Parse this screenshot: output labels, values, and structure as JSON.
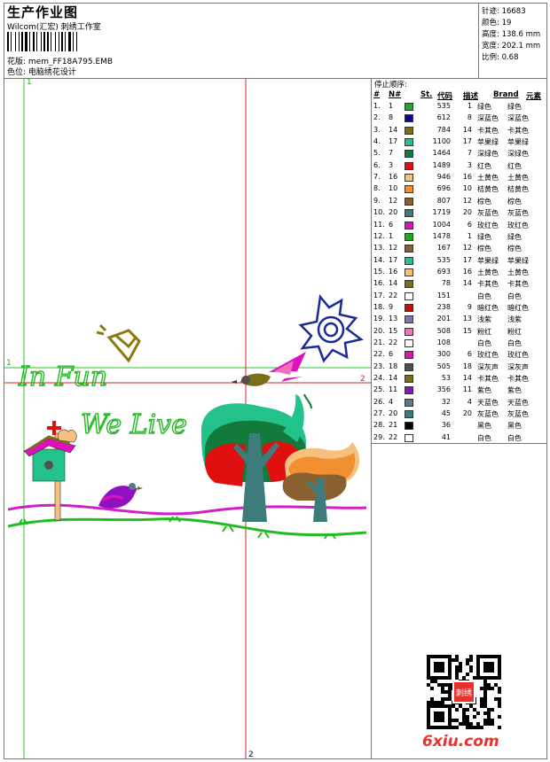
{
  "header": {
    "title": "生产作业图",
    "company": "Wilcom(汇宏) 刺绣工作室",
    "design_label": "花版: mem_FF18A795.EMB",
    "colorway_label": "色位: 电脑绣花设计"
  },
  "stats": [
    "针迹: 16683",
    "颜色: 19",
    "高度: 138.6 mm",
    "宽度: 202.1 mm",
    "比例: 0.68"
  ],
  "stop_sequence": {
    "title": "停止顺序:",
    "headers": [
      "#",
      "N#",
      "St.",
      "代码",
      "描述",
      "Brand",
      "元素"
    ],
    "rows": [
      {
        "num": "1.",
        "n": "1",
        "st": "535",
        "code": "1",
        "desc": "绿色",
        "brand": "绿色",
        "color": "#22aa22"
      },
      {
        "num": "2.",
        "n": "8",
        "st": "612",
        "code": "8",
        "desc": "深蓝色",
        "brand": "深蓝色",
        "color": "#0a0a8a"
      },
      {
        "num": "3.",
        "n": "14",
        "st": "784",
        "code": "14",
        "desc": "卡其色",
        "brand": "卡其色",
        "color": "#7a6e18"
      },
      {
        "num": "4.",
        "n": "17",
        "st": "1100",
        "code": "17",
        "desc": "苹果绿",
        "brand": "苹果绿",
        "color": "#22c28a"
      },
      {
        "num": "5.",
        "n": "7",
        "st": "1464",
        "code": "7",
        "desc": "深绿色",
        "brand": "深绿色",
        "color": "#127a3a"
      },
      {
        "num": "6.",
        "n": "3",
        "st": "1489",
        "code": "3",
        "desc": "红色",
        "brand": "红色",
        "color": "#e01010"
      },
      {
        "num": "7.",
        "n": "16",
        "st": "946",
        "code": "16",
        "desc": "土黄色",
        "brand": "土黄色",
        "color": "#f5c080"
      },
      {
        "num": "8.",
        "n": "10",
        "st": "696",
        "code": "10",
        "desc": "桔黄色",
        "brand": "桔黄色",
        "color": "#f09030"
      },
      {
        "num": "9.",
        "n": "12",
        "st": "807",
        "code": "12",
        "desc": "棕色",
        "brand": "棕色",
        "color": "#8a6030"
      },
      {
        "num": "10.",
        "n": "20",
        "st": "1719",
        "code": "20",
        "desc": "灰蓝色",
        "brand": "灰蓝色",
        "color": "#3e7c7c"
      },
      {
        "num": "11.",
        "n": "6",
        "st": "1004",
        "code": "6",
        "desc": "玫红色",
        "brand": "玫红色",
        "color": "#e010c0"
      },
      {
        "num": "12.",
        "n": "1",
        "st": "1478",
        "code": "1",
        "desc": "绿色",
        "brand": "绿色",
        "color": "#22aa22"
      },
      {
        "num": "13.",
        "n": "12",
        "st": "167",
        "code": "12",
        "desc": "棕色",
        "brand": "棕色",
        "color": "#8a6030"
      },
      {
        "num": "14.",
        "n": "17",
        "st": "535",
        "code": "17",
        "desc": "苹果绿",
        "brand": "苹果绿",
        "color": "#22c28a"
      },
      {
        "num": "15.",
        "n": "16",
        "st": "693",
        "code": "16",
        "desc": "土黄色",
        "brand": "土黄色",
        "color": "#f5c080"
      },
      {
        "num": "16.",
        "n": "14",
        "st": "78",
        "code": "14",
        "desc": "卡其色",
        "brand": "卡其色",
        "color": "#7a6e18"
      },
      {
        "num": "17.",
        "n": "22",
        "st": "151",
        "code": "",
        "desc": "白色",
        "brand": "白色",
        "color": "#ffffff"
      },
      {
        "num": "18.",
        "n": "9",
        "st": "238",
        "code": "9",
        "desc": "暗红色",
        "brand": "暗红色",
        "color": "#c01010"
      },
      {
        "num": "19.",
        "n": "13",
        "st": "201",
        "code": "13",
        "desc": "浅紫",
        "brand": "浅紫",
        "color": "#7878b8"
      },
      {
        "num": "20.",
        "n": "15",
        "st": "508",
        "code": "15",
        "desc": "粉红",
        "brand": "粉红",
        "color": "#f070c0"
      },
      {
        "num": "21.",
        "n": "22",
        "st": "108",
        "code": "",
        "desc": "白色",
        "brand": "白色",
        "color": "#ffffff"
      },
      {
        "num": "22.",
        "n": "6",
        "st": "300",
        "code": "6",
        "desc": "玫红色",
        "brand": "玫红色",
        "color": "#e010c0"
      },
      {
        "num": "23.",
        "n": "18",
        "st": "505",
        "code": "18",
        "desc": "深灰声",
        "brand": "深灰声",
        "color": "#505050"
      },
      {
        "num": "24.",
        "n": "14",
        "st": "53",
        "code": "14",
        "desc": "卡其色",
        "brand": "卡其色",
        "color": "#7a6e18"
      },
      {
        "num": "25.",
        "n": "11",
        "st": "356",
        "code": "11",
        "desc": "紫色",
        "brand": "紫色",
        "color": "#9010c0"
      },
      {
        "num": "26.",
        "n": "4",
        "st": "32",
        "code": "4",
        "desc": "天蓝色",
        "brand": "天蓝色",
        "color": "#5a7a8a"
      },
      {
        "num": "27.",
        "n": "20",
        "st": "45",
        "code": "20",
        "desc": "灰蓝色",
        "brand": "灰蓝色",
        "color": "#3e7c7c"
      },
      {
        "num": "28.",
        "n": "21",
        "st": "36",
        "code": "",
        "desc": "黑色",
        "brand": "黑色",
        "color": "#000000"
      },
      {
        "num": "29.",
        "n": "22",
        "st": "41",
        "code": "",
        "desc": "白色",
        "brand": "白色",
        "color": "#ffffff"
      }
    ]
  },
  "canvas": {
    "axis_labels": {
      "top_left": "1",
      "left_mid": "1",
      "right_mid": "2",
      "bottom": "2"
    },
    "text_in_fun": "In Fun",
    "text_we_live": "We Live"
  },
  "footer": {
    "watermark": "6xiu.com",
    "qr_badge": "刺绣"
  }
}
